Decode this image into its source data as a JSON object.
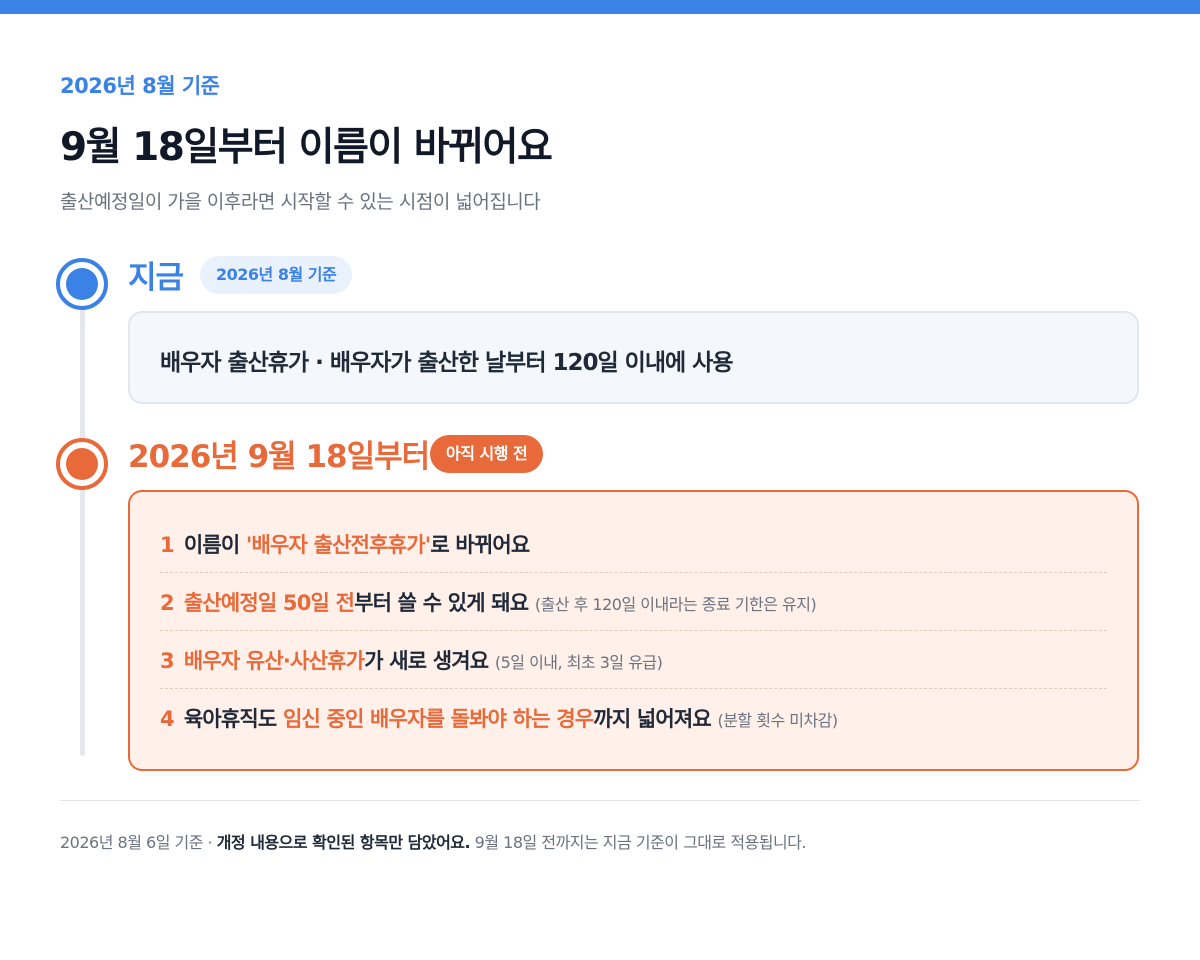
{
  "colors": {
    "accent_blue": "#3b82e6",
    "accent_orange": "#e8693a",
    "card_blue_bg": "#f4f7fb",
    "card_orange_bg": "#fff0ea",
    "text_dark": "#1f2937",
    "text_muted": "#6b7280"
  },
  "header": {
    "eyebrow": "2026년 8월 기준",
    "title": "9월 18일부터 이름이 바뀌어요",
    "subtitle": "출산예정일이 가을 이후라면 시작할 수 있는 시점이 넓어집니다"
  },
  "now": {
    "heading": "지금",
    "badge": "2026년 8월 기준",
    "card_text": "배우자 출산휴가 · 배우자가 출산한 날부터 120일 이내에 사용"
  },
  "future": {
    "heading": "2026년 9월 18일부터",
    "badge": "아직 시행 전",
    "changes": [
      {
        "num": "1",
        "pre": "이름이 ",
        "highlight": "'배우자 출산전후휴가'",
        "post": "로 바뀌어요",
        "note": ""
      },
      {
        "num": "2",
        "pre": "",
        "highlight": "출산예정일 50일 전",
        "post": "부터 쓸 수 있게 돼요",
        "note": "(출산 후 120일 이내라는 종료 기한은 유지)"
      },
      {
        "num": "3",
        "pre": "",
        "highlight": "배우자 유산·사산휴가",
        "post": "가 새로 생겨요",
        "note": "(5일 이내, 최초 3일 유급)"
      },
      {
        "num": "4",
        "pre": "육아휴직도 ",
        "highlight": "임신 중인 배우자를 돌봐야 하는 경우",
        "post": "까지 넓어져요",
        "note": "(분할 횟수 미차감)"
      }
    ]
  },
  "footer": {
    "date_prefix": "2026년 8월 6일 기준 · ",
    "strong": "개정 내용으로 확인된 항목만 담았어요.",
    "suffix": " 9월 18일 전까지는 지금 기준이 그대로 적용됩니다."
  }
}
